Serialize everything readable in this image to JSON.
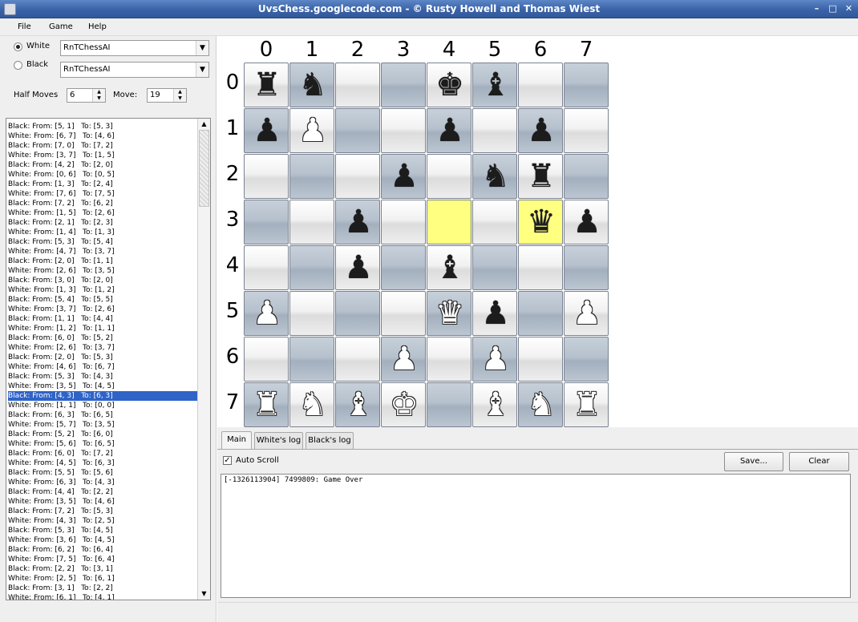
{
  "window": {
    "title": "UvsChess.googlecode.com - © Rusty Howell and Thomas Wiest"
  },
  "menu": [
    "File",
    "Game",
    "Help"
  ],
  "players": {
    "white": {
      "label": "White",
      "ai": "RnTChessAI",
      "selected": true
    },
    "black": {
      "label": "Black",
      "ai": "RnTChessAI",
      "selected": false
    }
  },
  "controls": {
    "half_moves_label": "Half Moves",
    "half_moves_value": "6",
    "move_label": "Move:",
    "move_value": "19"
  },
  "moves": [
    "Black: From: [5, 1]   To: [5, 3]",
    "White: From: [6, 7]   To: [4, 6]",
    "Black: From: [7, 0]   To: [7, 2]",
    "White: From: [3, 7]   To: [1, 5]",
    "Black: From: [4, 2]   To: [2, 0]",
    "White: From: [0, 6]   To: [0, 5]",
    "Black: From: [1, 3]   To: [2, 4]",
    "White: From: [7, 6]   To: [7, 5]",
    "Black: From: [7, 2]   To: [6, 2]",
    "White: From: [1, 5]   To: [2, 6]",
    "Black: From: [2, 1]   To: [2, 3]",
    "White: From: [1, 4]   To: [1, 3]",
    "Black: From: [5, 3]   To: [5, 4]",
    "White: From: [4, 7]   To: [3, 7]",
    "Black: From: [2, 0]   To: [1, 1]",
    "White: From: [2, 6]   To: [3, 5]",
    "Black: From: [3, 0]   To: [2, 0]",
    "White: From: [1, 3]   To: [1, 2]",
    "Black: From: [5, 4]   To: [5, 5]",
    "White: From: [3, 7]   To: [2, 6]",
    "Black: From: [1, 1]   To: [4, 4]",
    "White: From: [1, 2]   To: [1, 1]",
    "Black: From: [6, 0]   To: [5, 2]",
    "White: From: [2, 6]   To: [3, 7]",
    "Black: From: [2, 0]   To: [5, 3]",
    "White: From: [4, 6]   To: [6, 7]",
    "Black: From: [5, 3]   To: [4, 3]",
    "White: From: [3, 5]   To: [4, 5]",
    "Black: From: [4, 3]   To: [6, 3]",
    "White: From: [1, 1]   To: [0, 0]",
    "Black: From: [6, 3]   To: [6, 5]",
    "White: From: [5, 7]   To: [3, 5]",
    "Black: From: [5, 2]   To: [6, 0]",
    "White: From: [5, 6]   To: [6, 5]",
    "Black: From: [6, 0]   To: [7, 2]",
    "White: From: [4, 5]   To: [6, 3]",
    "Black: From: [5, 5]   To: [5, 6]",
    "White: From: [6, 3]   To: [4, 3]",
    "Black: From: [4, 4]   To: [2, 2]",
    "White: From: [3, 5]   To: [4, 6]",
    "Black: From: [7, 2]   To: [5, 3]",
    "White: From: [4, 3]   To: [2, 5]",
    "Black: From: [5, 3]   To: [4, 5]",
    "White: From: [3, 6]   To: [4, 5]",
    "Black: From: [6, 2]   To: [6, 4]",
    "White: From: [7, 5]   To: [6, 4]",
    "Black: From: [2, 2]   To: [3, 1]",
    "White: From: [2, 5]   To: [6, 1]",
    "Black: From: [3, 1]   To: [2, 2]",
    "White: From: [6, 1]   To: [4, 1]"
  ],
  "selected_move_index": 28,
  "board": {
    "col_labels": [
      "0",
      "1",
      "2",
      "3",
      "4",
      "5",
      "6",
      "7"
    ],
    "row_labels": [
      "0",
      "1",
      "2",
      "3",
      "4",
      "5",
      "6",
      "7"
    ],
    "highlight": [
      [
        3,
        4
      ],
      [
        3,
        6
      ]
    ],
    "pieces": [
      [
        0,
        0,
        "black",
        "rook"
      ],
      [
        0,
        1,
        "black",
        "knight"
      ],
      [
        0,
        4,
        "black",
        "king"
      ],
      [
        0,
        5,
        "black",
        "bishop"
      ],
      [
        1,
        0,
        "black",
        "pawn"
      ],
      [
        1,
        1,
        "white",
        "pawn"
      ],
      [
        1,
        4,
        "black",
        "pawn"
      ],
      [
        1,
        6,
        "black",
        "pawn"
      ],
      [
        2,
        3,
        "black",
        "pawn"
      ],
      [
        2,
        5,
        "black",
        "knight"
      ],
      [
        2,
        6,
        "black",
        "rook"
      ],
      [
        3,
        2,
        "black",
        "pawn"
      ],
      [
        3,
        6,
        "black",
        "queen"
      ],
      [
        3,
        7,
        "black",
        "pawn"
      ],
      [
        4,
        2,
        "black",
        "pawn"
      ],
      [
        4,
        4,
        "black",
        "bishop"
      ],
      [
        5,
        0,
        "white",
        "pawn"
      ],
      [
        5,
        4,
        "white",
        "queen"
      ],
      [
        5,
        5,
        "black",
        "pawn"
      ],
      [
        5,
        7,
        "white",
        "pawn"
      ],
      [
        6,
        3,
        "white",
        "pawn"
      ],
      [
        6,
        5,
        "white",
        "pawn"
      ],
      [
        7,
        0,
        "white",
        "rook"
      ],
      [
        7,
        1,
        "white",
        "knight"
      ],
      [
        7,
        2,
        "white",
        "bishop"
      ],
      [
        7,
        3,
        "white",
        "king"
      ],
      [
        7,
        5,
        "white",
        "bishop"
      ],
      [
        7,
        6,
        "white",
        "knight"
      ],
      [
        7,
        7,
        "white",
        "rook"
      ]
    ]
  },
  "tabs": [
    "Main",
    "White's log",
    "Black's log"
  ],
  "active_tab": "Main",
  "autoscroll": {
    "label": "Auto Scroll",
    "checked": true
  },
  "buttons": {
    "save": "Save...",
    "clear": "Clear"
  },
  "log": "[-1326113904] 7499809: Game Over",
  "colors": {
    "highlight": "#ffff80",
    "selection": "#2f63c8",
    "titlebar": "#3a63a8"
  }
}
